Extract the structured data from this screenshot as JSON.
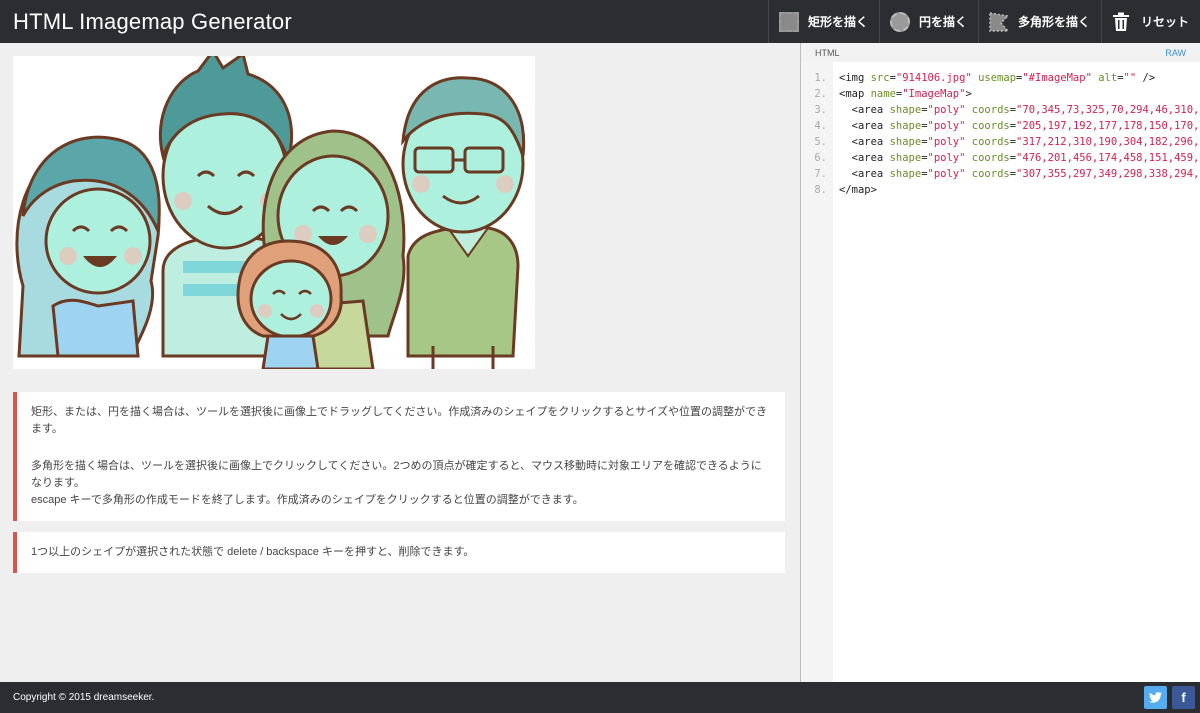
{
  "header": {
    "title": "HTML Imagemap Generator",
    "tools": [
      {
        "label": "矩形を描く",
        "icon": "rectangle-icon"
      },
      {
        "label": "円を描く",
        "icon": "circle-icon"
      },
      {
        "label": "多角形を描く",
        "icon": "polygon-icon"
      },
      {
        "label": "リセット",
        "icon": "trash-icon"
      }
    ]
  },
  "image": {
    "subject": "family-illustration"
  },
  "notes": [
    {
      "lines": [
        "矩形、または、円を描く場合は、ツールを選択後に画像上でドラッグしてください。作成済みのシェイプをクリックするとサイズや位置の調整ができます。"
      ]
    },
    {
      "lines": [
        "多角形を描く場合は、ツールを選択後に画像上でクリックしてください。2つめの頂点が確定すると、マウス移動時に対象エリアを確認できるようになります。",
        "escape キーで多角形の作成モードを終了します。作成済みのシェイプをクリックすると位置の調整ができます。"
      ]
    },
    {
      "lines": [
        "1つ以上のシェイプが選択された状態で delete / backspace キーを押すと、削除できます。"
      ]
    }
  ],
  "code_panel": {
    "tab_label": "HTML",
    "raw_label": "RAW",
    "line_numbers": [
      "1.",
      "2.",
      "3.",
      "4.",
      "5.",
      "6.",
      "7.",
      "8."
    ],
    "lines": [
      "<img src=\"914106.jpg\" usemap=\"#ImageMap\" alt=\"\" />",
      "<map name=\"ImageMap\">",
      "  <area shape=\"poly\" coords=\"70,345,73,325,70,294,46,310,3",
      "  <area shape=\"poly\" coords=\"205,197,192,177,178,150,170,1",
      "  <area shape=\"poly\" coords=\"317,212,310,190,304,182,296,1",
      "  <area shape=\"poly\" coords=\"476,201,456,174,458,151,459,1",
      "  <area shape=\"poly\" coords=\"307,355,297,349,298,338,294,3",
      "</map>"
    ]
  },
  "footer": {
    "copyright": "Copyright © 2015 dreamseeker.",
    "twitter_icon": "twitter-icon",
    "facebook_icon": "facebook-icon"
  },
  "colors": {
    "header_bg": "#2c2d30",
    "note_accent": "#d9534f",
    "raw_link": "#3b8ed3",
    "code_string": "#d6204f",
    "code_attr": "#6b8e23",
    "twitter": "#55acee",
    "facebook": "#3b5998"
  }
}
